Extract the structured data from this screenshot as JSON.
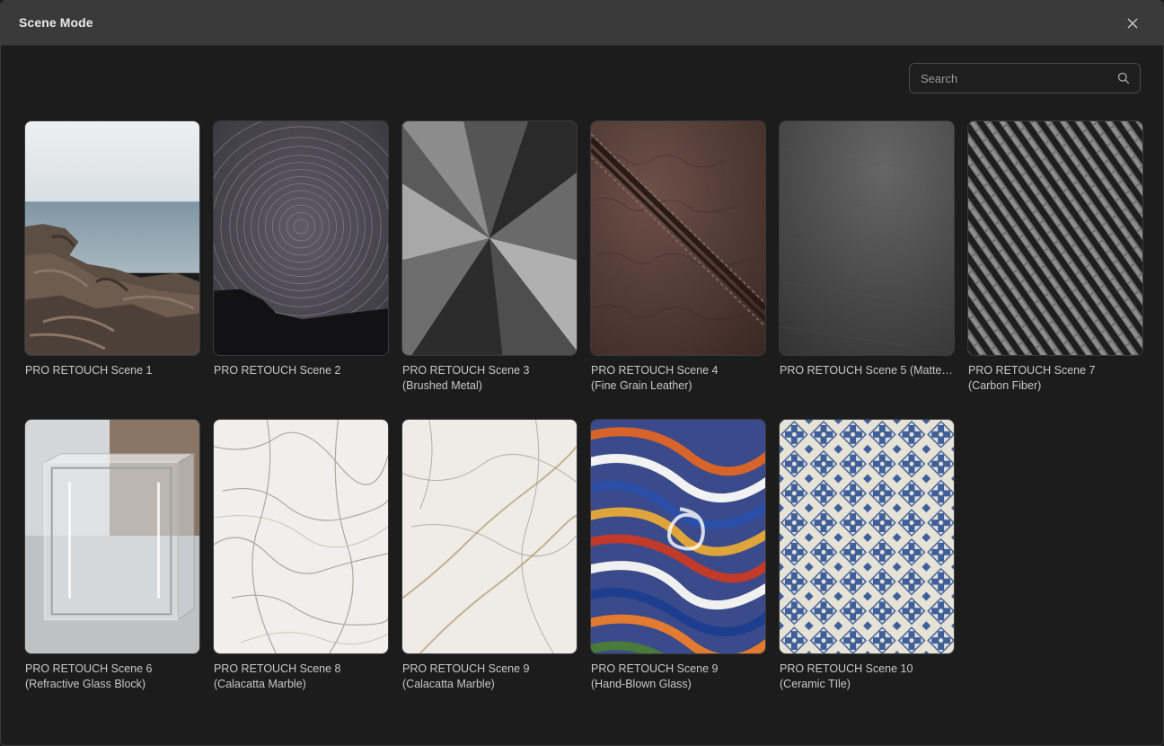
{
  "window": {
    "title": "Scene Mode",
    "close_icon": "close-icon"
  },
  "search": {
    "placeholder": "Search",
    "value": "",
    "icon": "search-icon"
  },
  "scenes": [
    {
      "line1": "PRO RETOUCH Scene 1",
      "line2": "",
      "thumb": "seascape"
    },
    {
      "line1": "PRO RETOUCH Scene 2",
      "line2": "",
      "thumb": "star-trails"
    },
    {
      "line1": "PRO RETOUCH Scene 3",
      "line2": "(Brushed Metal)",
      "thumb": "brushed-metal"
    },
    {
      "line1": "PRO RETOUCH Scene 4",
      "line2": "(Fine Grain Leather)",
      "thumb": "leather"
    },
    {
      "line1": "PRO RETOUCH Scene 5 (Matte Te...",
      "line2": "",
      "thumb": "matte-texture"
    },
    {
      "line1": "PRO RETOUCH Scene 7",
      "line2": "(Carbon Fiber)",
      "thumb": "carbon-fiber"
    },
    {
      "line1": "PRO RETOUCH Scene 6",
      "line2": "(Refractive Glass Block)",
      "thumb": "glass-block"
    },
    {
      "line1": "PRO RETOUCH Scene 8",
      "line2": "(Calacatta Marble)",
      "thumb": "marble-a"
    },
    {
      "line1": "PRO RETOUCH Scene 9",
      "line2": "(Calacatta Marble)",
      "thumb": "marble-b"
    },
    {
      "line1": "PRO RETOUCH Scene 9",
      "line2": "(Hand-Blown Glass)",
      "thumb": "blown-glass"
    },
    {
      "line1": "PRO RETOUCH Scene 10",
      "line2": "(Ceramic TIle)",
      "thumb": "ceramic-tile"
    }
  ],
  "colors": {
    "background": "#1c1c1c",
    "titlebar": "#3a3a3a",
    "text": "#c8c8c8"
  }
}
